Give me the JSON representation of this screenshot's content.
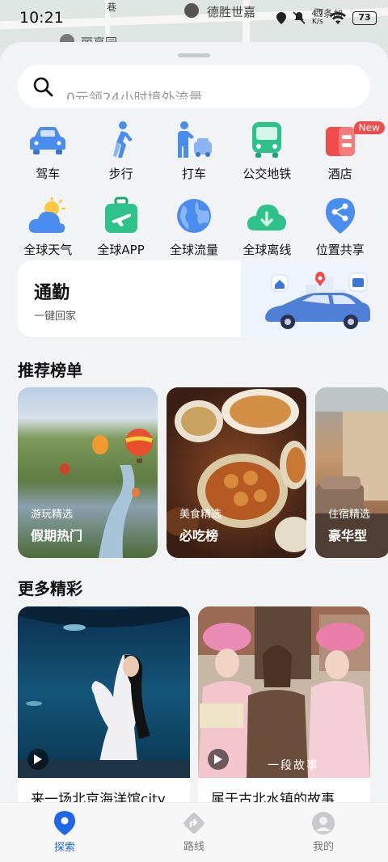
{
  "status_bar": {
    "time": "10:21",
    "net_speed_value": "4.7",
    "net_speed_unit": "K/s",
    "battery": "73"
  },
  "map": {
    "labels": [
      "德胜世嘉",
      "西条胡",
      "丽亭园",
      "巷"
    ]
  },
  "search": {
    "placeholder": "0元领24小时境外流量"
  },
  "quick_actions": [
    {
      "label": "驾车",
      "icon": "car-icon",
      "color": "#4a8df0"
    },
    {
      "label": "步行",
      "icon": "walk-icon",
      "color": "#4a8df0"
    },
    {
      "label": "打车",
      "icon": "taxi-icon",
      "color": "#4a8df0"
    },
    {
      "label": "公交地铁",
      "icon": "bus-icon",
      "color": "#2cc28a"
    },
    {
      "label": "酒店",
      "icon": "hotel-icon",
      "color": "#f14b4b",
      "badge": "New"
    },
    {
      "label": "全球天气",
      "icon": "weather-icon",
      "color": "#4a8df0"
    },
    {
      "label": "全球APP",
      "icon": "luggage-icon",
      "color": "#2cc28a"
    },
    {
      "label": "全球流量",
      "icon": "globe-icon",
      "color": "#4a8df0"
    },
    {
      "label": "全球离线",
      "icon": "cloud-download-icon",
      "color": "#2cc28a"
    },
    {
      "label": "位置共享",
      "icon": "share-location-icon",
      "color": "#4a8df0"
    }
  ],
  "commute": {
    "title": "通勤",
    "subtitle": "一键回家"
  },
  "recommended": {
    "title": "推荐榜单",
    "cards": [
      {
        "category": "游玩精选",
        "name": "假期热门"
      },
      {
        "category": "美食精选",
        "name": "必吃榜"
      },
      {
        "category": "住宿精选",
        "name": "豪华型"
      }
    ]
  },
  "more": {
    "title": "更多精彩",
    "cards": [
      {
        "title": "来一场北京海洋馆city"
      },
      {
        "title": "属于古北水镇的故事",
        "overlay_text": "一段故事"
      }
    ]
  },
  "bottom_nav": [
    {
      "label": "探索",
      "active": true
    },
    {
      "label": "路线",
      "active": false
    },
    {
      "label": "我的",
      "active": false
    }
  ],
  "colors": {
    "accent": "#1e67e8",
    "background": "#f2f3f5"
  }
}
